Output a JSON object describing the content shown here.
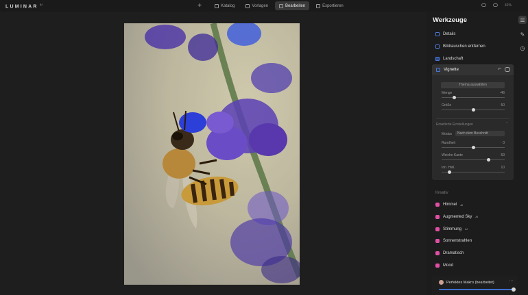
{
  "app": {
    "brand": "LUMINAR",
    "version": "AI"
  },
  "topnav": {
    "items": [
      {
        "label": "Katalog"
      },
      {
        "label": "Vorlagen"
      },
      {
        "label": "Bearbeiten"
      },
      {
        "label": "Exportieren"
      }
    ],
    "zoom": "41%"
  },
  "panel": {
    "title": "Werkzeuge",
    "tools": [
      {
        "label": "Details"
      },
      {
        "label": "Bildrauschen entfernen"
      },
      {
        "label": "Landschaft"
      }
    ],
    "vignette": {
      "title": "Vignette",
      "theme_button": "Thema auswählen",
      "sliders": [
        {
          "label": "Menge",
          "value": "-46",
          "fraction": 0.2
        },
        {
          "label": "Größe",
          "value": "50",
          "fraction": 0.5
        }
      ],
      "advanced_label": "Erweiterte Einstellungen",
      "modus_label": "Modus",
      "modus_value": "Nach dem Beschnitt",
      "advanced_sliders": [
        {
          "label": "Rundheit",
          "value": "0",
          "fraction": 0.5
        },
        {
          "label": "Weiche Kante",
          "value": "59",
          "fraction": 0.74
        },
        {
          "label": "Inn. Hell.",
          "value": "10",
          "fraction": 0.12
        }
      ]
    },
    "kreativ_title": "Kreativ",
    "kreativ_tools": [
      {
        "label": "Himmel",
        "badge": "AI",
        "color": "#e04fa5"
      },
      {
        "label": "Augmented Sky",
        "badge": "AI",
        "color": "#e04fa5"
      },
      {
        "label": "Stimmung",
        "badge": "AI",
        "color": "#e04fa5"
      },
      {
        "label": "Sonnenstrahlen",
        "badge": "",
        "color": "#e04fa5"
      },
      {
        "label": "Dramatisch",
        "badge": "",
        "color": "#e04fa5"
      },
      {
        "label": "Mood",
        "badge": "",
        "color": "#e04fa5"
      }
    ],
    "preset": {
      "name": "Perfektes Makro (bearbeitet)",
      "amount_fraction": 1.0
    }
  },
  "colors": {
    "accent": "#3f6fd0",
    "kreativ": "#e04fa5",
    "panel_bg": "#1c1c1c"
  }
}
